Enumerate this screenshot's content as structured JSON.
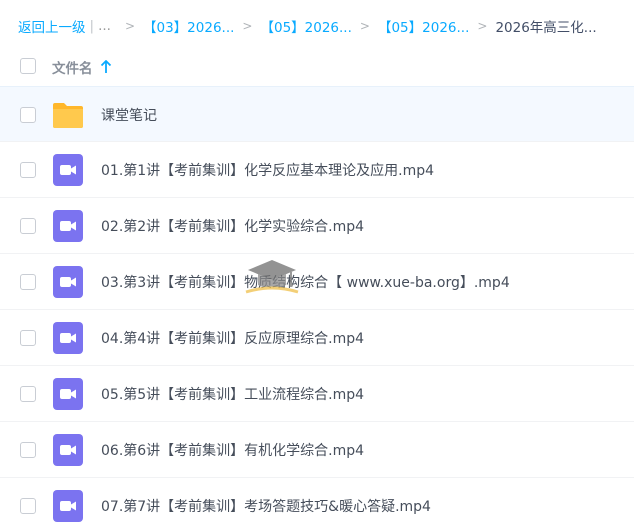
{
  "breadcrumb": {
    "back_label": "返回上一级",
    "divider": "|",
    "ellipsis": "...",
    "arrow": ">",
    "crumbs": [
      "【03】2026...",
      "【05】2026...",
      "【05】2026..."
    ],
    "current": "2026年高三化..."
  },
  "header": {
    "name_column": "文件名",
    "sort": "ascending"
  },
  "files": [
    {
      "name": "课堂笔记",
      "type": "folder",
      "icon": "folder-icon"
    },
    {
      "name": "01.第1讲【考前集训】化学反应基本理论及应用.mp4",
      "type": "video",
      "icon": "video-icon"
    },
    {
      "name": "02.第2讲【考前集训】化学实验综合.mp4",
      "type": "video",
      "icon": "video-icon"
    },
    {
      "name": "03.第3讲【考前集训】物质结构综合【 www.xue-ba.org】.mp4",
      "type": "video",
      "icon": "video-icon"
    },
    {
      "name": "04.第4讲【考前集训】反应原理综合.mp4",
      "type": "video",
      "icon": "video-icon"
    },
    {
      "name": "05.第5讲【考前集训】工业流程综合.mp4",
      "type": "video",
      "icon": "video-icon"
    },
    {
      "name": "06.第6讲【考前集训】有机化学综合.mp4",
      "type": "video",
      "icon": "video-icon"
    },
    {
      "name": "07.第7讲【考前集训】考场答题技巧&暖心答疑.mp4",
      "type": "video",
      "icon": "video-icon"
    }
  ],
  "colors": {
    "link": "#09AAFF",
    "folder": "#FFC94D",
    "video": "#7B73F0",
    "highlight_row": "#F4F9FF"
  }
}
